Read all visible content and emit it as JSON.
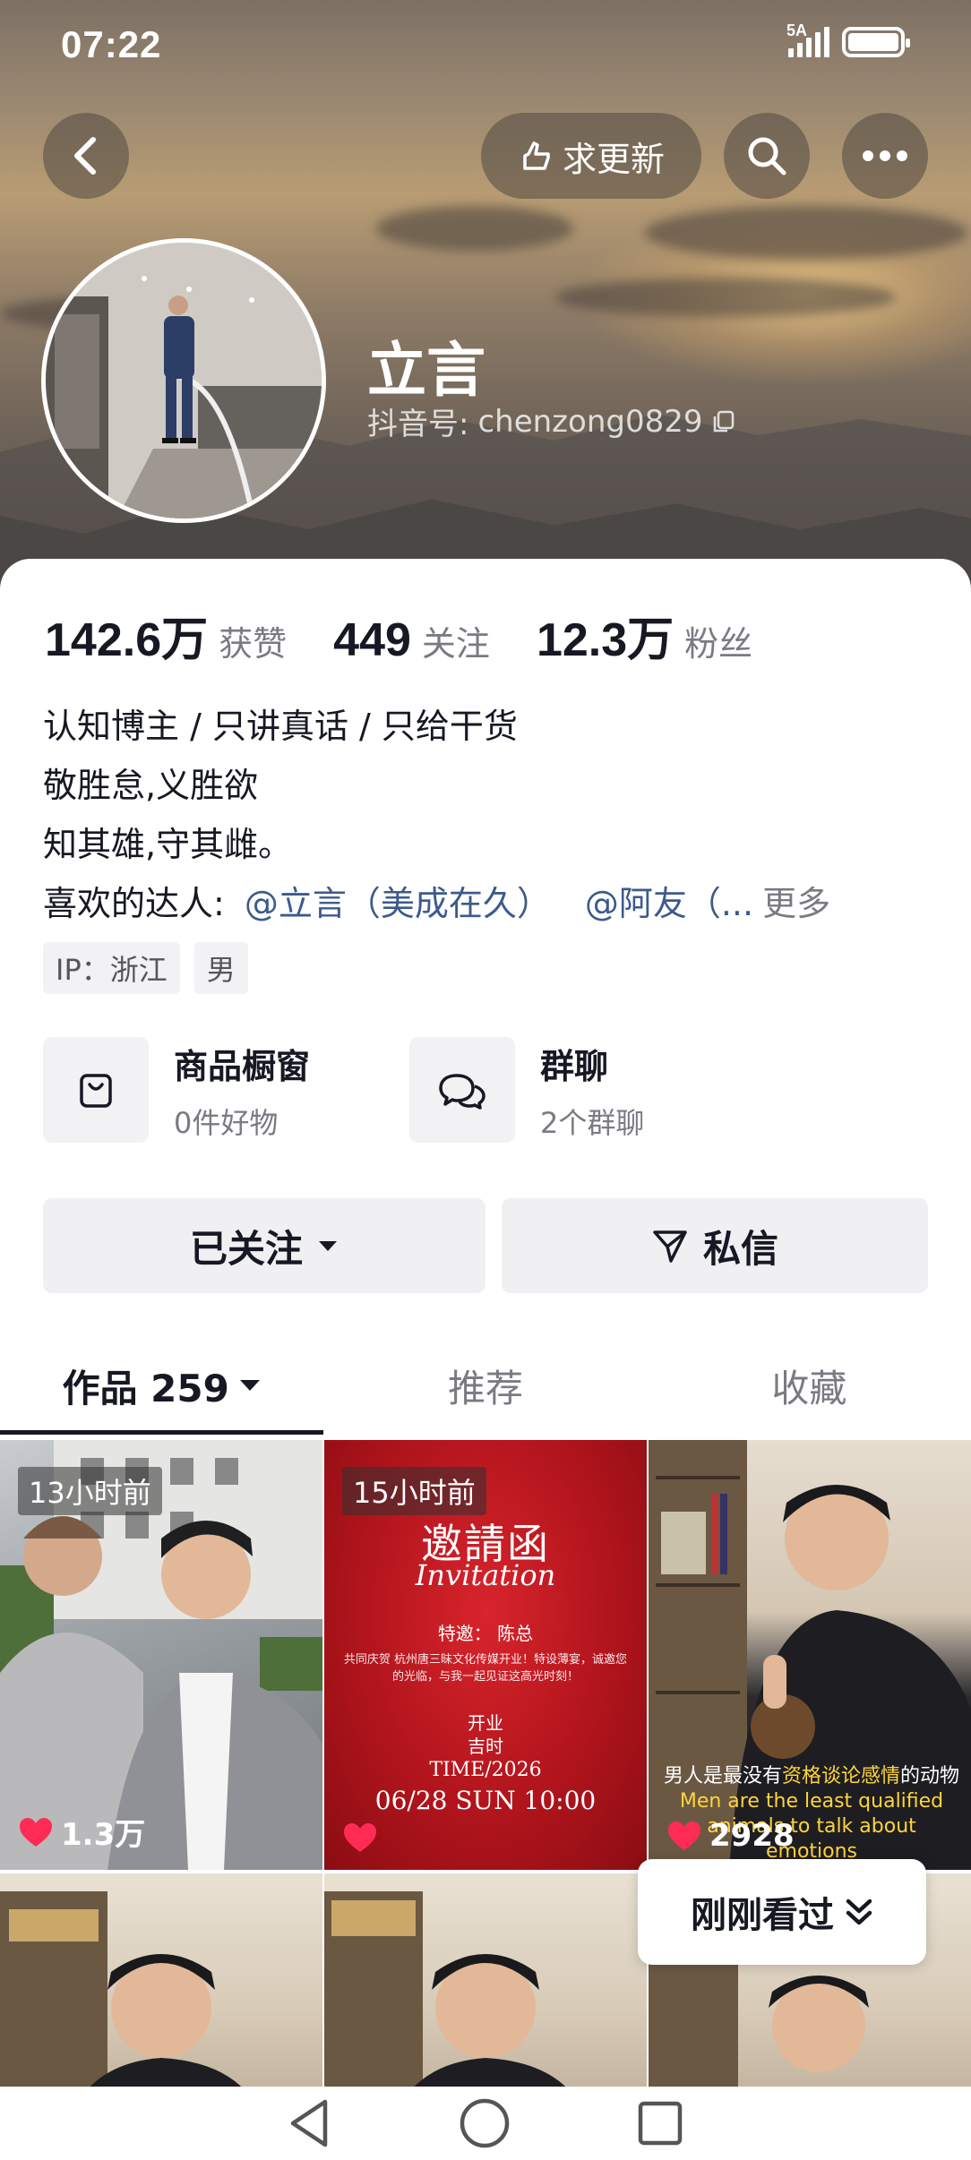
{
  "status_bar": {
    "time": "07:22",
    "network": "5A"
  },
  "header": {
    "request_update_label": "求更新",
    "back_icon": "back-arrow-icon",
    "search_icon": "search-icon",
    "more_icon": "more-icon"
  },
  "profile": {
    "name": "立言",
    "douyin_id_label": "抖音号:",
    "douyin_id": "chenzong0829"
  },
  "stats": [
    {
      "value": "142.6万",
      "label": "获赞"
    },
    {
      "value": "449",
      "label": "关注"
    },
    {
      "value": "12.3万",
      "label": "粉丝"
    }
  ],
  "bio": {
    "lines": [
      "认知博主 / 只讲真话 / 只给干货",
      "敬胜怠,义胜欲",
      "知其雄,守其雌。"
    ],
    "liked_label": "喜欢的达人:",
    "mentions": [
      "@立言（美成在久）",
      "@阿友（..."
    ],
    "more": "更多"
  },
  "tags": [
    "IP：浙江",
    "男"
  ],
  "features": [
    {
      "title": "商品橱窗",
      "sub": "0件好物",
      "icon": "bag-icon"
    },
    {
      "title": "群聊",
      "sub": "2个群聊",
      "icon": "chat-bubbles-icon"
    }
  ],
  "actions": {
    "follow": "已关注",
    "message": "私信"
  },
  "tabs": [
    {
      "label": "作品 259",
      "active": true
    },
    {
      "label": "推荐",
      "active": false
    },
    {
      "label": "收藏",
      "active": false
    }
  ],
  "videos": [
    {
      "time": "13小时前",
      "likes": "1.3万"
    },
    {
      "time": "15小时前",
      "likes": "",
      "invitation": {
        "title_cn": "邀請函",
        "title_en": "Invitation",
        "guest": "特邀：      陈总",
        "body": "共同庆贺 杭州唐三昧文化传媒开业！特设薄宴，诚邀您的光临，与我一起见证这高光时刻！",
        "line1": "开业",
        "line2": "吉时",
        "time": "TIME/2026",
        "date": "06/28 SUN 10:00"
      }
    },
    {
      "time": "",
      "likes": "2928",
      "caption_cn_pre": "男人是最没有",
      "caption_cn_hl": "资格谈论感情",
      "caption_cn_post": "的动物",
      "caption_en": "Men are the least qualified animals to talk about emotions"
    },
    {
      "time": "",
      "likes": ""
    },
    {
      "time": "",
      "likes": ""
    },
    {
      "time": "",
      "likes": ""
    }
  ],
  "recently_viewed": "刚刚看过",
  "colors": {
    "accent_like": "#fe2c55",
    "mention": "#3c5a8c",
    "caption_highlight": "#ffd43b"
  }
}
